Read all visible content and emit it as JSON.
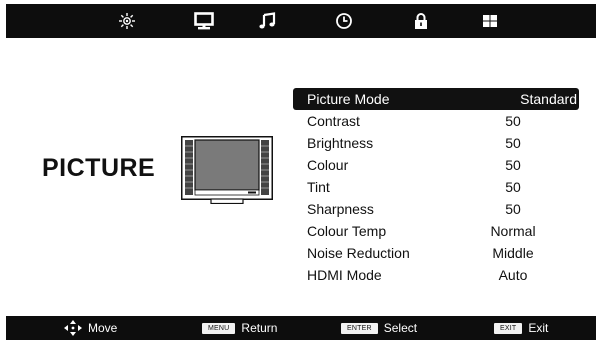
{
  "tabs": [
    {
      "name": "picture",
      "icon": "picture-settings-icon"
    },
    {
      "name": "display",
      "icon": "monitor-icon"
    },
    {
      "name": "sound",
      "icon": "music-note-icon"
    },
    {
      "name": "time",
      "icon": "clock-icon"
    },
    {
      "name": "lock",
      "icon": "padlock-icon"
    },
    {
      "name": "setup",
      "icon": "grid-icon"
    }
  ],
  "section_title": "PICTURE",
  "menu": {
    "items": [
      {
        "label": "Picture Mode",
        "value": "Standard",
        "selected": true
      },
      {
        "label": "Contrast",
        "value": "50"
      },
      {
        "label": "Brightness",
        "value": "50"
      },
      {
        "label": "Colour",
        "value": "50"
      },
      {
        "label": "Tint",
        "value": "50"
      },
      {
        "label": "Sharpness",
        "value": "50"
      },
      {
        "label": "Colour Temp",
        "value": "Normal"
      },
      {
        "label": "Noise Reduction",
        "value": "Middle"
      },
      {
        "label": "HDMI Mode",
        "value": "Auto"
      }
    ]
  },
  "footer": {
    "move_label": "Move",
    "menu_key": "MENU",
    "return_label": "Return",
    "enter_key": "ENTER",
    "select_label": "Select",
    "exit_key": "EXIT",
    "exit_label": "Exit"
  },
  "colors": {
    "bar": "#0d0d0d",
    "highlight": "#111111",
    "background": "#ffffff"
  }
}
